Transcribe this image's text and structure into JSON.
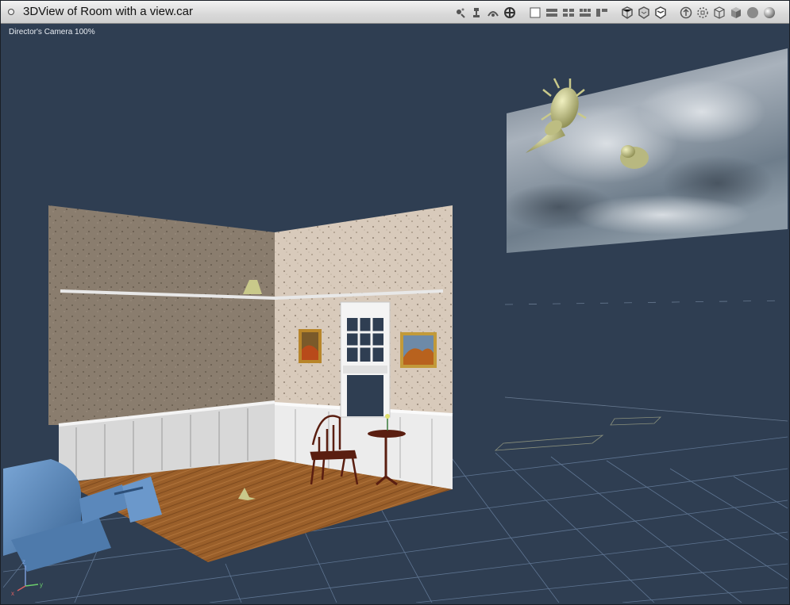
{
  "window": {
    "title": "3DView of Room with a view.car"
  },
  "viewport": {
    "camera_label": "Director's Camera 100%",
    "axis_labels": {
      "x": "x",
      "y": "y",
      "z": "z"
    }
  },
  "toolbar": {
    "groups": [
      [
        "camera-move-icon",
        "camera-dolly-icon",
        "camera-orbit-icon",
        "camera-target-icon"
      ],
      [
        "single-view-icon",
        "two-views-icon",
        "four-views-icon",
        "three-views-icon",
        "layout-views-icon"
      ],
      [
        "bounding-box-icon",
        "wireframe-shield-icon",
        "hidden-line-icon"
      ],
      [
        "up-arrow-icon",
        "dotted-cube-icon",
        "wire-cube-icon",
        "solid-cube-icon",
        "flat-sphere-icon",
        "shaded-sphere-icon"
      ]
    ]
  },
  "colors": {
    "viewport_bg": "#2f3e52",
    "grid_line": "#6f88a8",
    "wall_left": "#8a7d6e",
    "wall_right": "#d8cabb",
    "floor": "#9a5f2a",
    "projector": "#5a86b8",
    "prop": "#c9c98a"
  }
}
